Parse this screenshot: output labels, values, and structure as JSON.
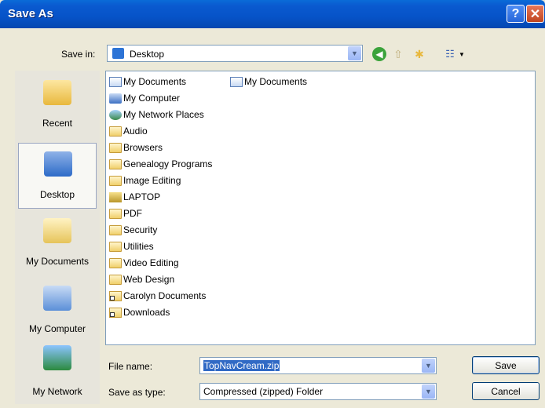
{
  "window": {
    "title": "Save As",
    "help_label": "?",
    "close_label": "✕"
  },
  "savein": {
    "label": "Save in:",
    "value": "Desktop",
    "arrow": "▼"
  },
  "toolbar": {
    "back_icon": "go-back-icon",
    "back_glyph": "◀",
    "up_icon": "up-one-level-icon",
    "up_glyph": "⇧",
    "newfolder_icon": "new-folder-icon",
    "newfolder_glyph": "✱",
    "view_icon": "view-menu-icon",
    "view_glyph": "☷",
    "view_arrow": "▼"
  },
  "places": [
    {
      "label": "Recent",
      "icon": "recent-icon"
    },
    {
      "label": "Desktop",
      "icon": "desktop-icon",
      "selected": true
    },
    {
      "label": "My Documents",
      "icon": "my-documents-icon"
    },
    {
      "label": "My Computer",
      "icon": "my-computer-icon"
    },
    {
      "label": "My Network",
      "icon": "my-network-icon"
    }
  ],
  "files": [
    {
      "name": "My Documents",
      "icon": "my-documents-icon"
    },
    {
      "name": "My Computer",
      "icon": "my-computer-icon"
    },
    {
      "name": "My Network Places",
      "icon": "network-places-icon"
    },
    {
      "name": "Audio",
      "icon": "folder-icon"
    },
    {
      "name": "Browsers",
      "icon": "folder-icon"
    },
    {
      "name": "Genealogy Programs",
      "icon": "folder-icon"
    },
    {
      "name": "Image Editing",
      "icon": "folder-icon"
    },
    {
      "name": "LAPTOP",
      "icon": "laptop-icon"
    },
    {
      "name": "PDF",
      "icon": "folder-icon"
    },
    {
      "name": "Security",
      "icon": "folder-icon"
    },
    {
      "name": "Utilities",
      "icon": "folder-icon"
    },
    {
      "name": "Video Editing",
      "icon": "folder-icon"
    },
    {
      "name": "Web Design",
      "icon": "folder-icon"
    },
    {
      "name": "Carolyn Documents",
      "icon": "folder-shortcut-icon"
    },
    {
      "name": "Downloads",
      "icon": "folder-shortcut-icon"
    },
    {
      "name": "My Documents",
      "icon": "documents-shortcut-icon"
    }
  ],
  "filename": {
    "label": "File name:",
    "value": "TopNavCream.zip",
    "arrow": "▼"
  },
  "savetype": {
    "label": "Save as type:",
    "value": "Compressed (zipped) Folder",
    "arrow": "▼"
  },
  "buttons": {
    "save": "Save",
    "cancel": "Cancel"
  }
}
